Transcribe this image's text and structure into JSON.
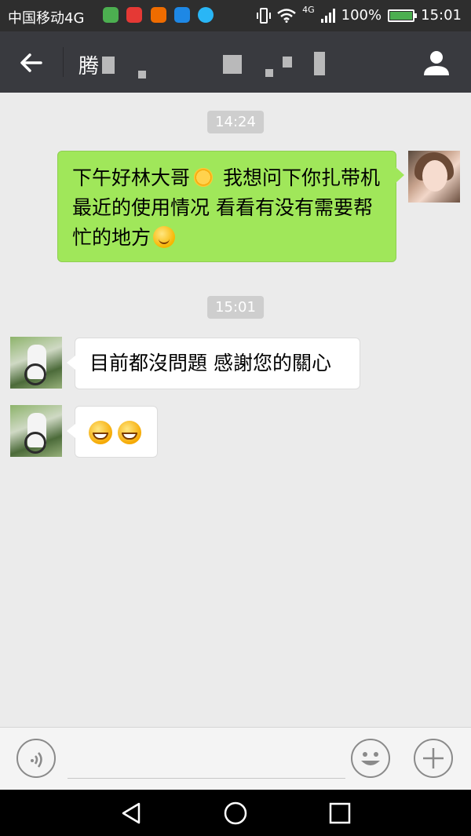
{
  "status_bar": {
    "carrier": "中国移动4G",
    "network": "4G",
    "battery": "100%",
    "battery_level": 1.0,
    "time": "15:01",
    "notification_icons": [
      "wechat-icon",
      "mail-icon",
      "sad-face-icon",
      "gallery-icon",
      "message-icon"
    ],
    "notification_colors": [
      "#4caf50",
      "#e53935",
      "#ef6c00",
      "#1e88e5",
      "#29b6f6"
    ]
  },
  "title_bar": {
    "title": "腾"
  },
  "messages": [
    {
      "type": "timestamp",
      "text": "14:24"
    },
    {
      "type": "sent",
      "text_part1": "下午好林大哥",
      "text_part2": " 我想问下你扎带机最近的使用情况 看看有没有需要帮忙的地方",
      "emoji": [
        "sun-emoji",
        "smile-emoji"
      ]
    },
    {
      "type": "timestamp",
      "text": "15:01"
    },
    {
      "type": "received",
      "text": "目前都沒問題 感謝您的關心"
    },
    {
      "type": "received",
      "emoji": [
        "grin-emoji",
        "grin-emoji"
      ]
    }
  ],
  "input_bar": {
    "placeholder": ""
  },
  "colors": {
    "sent_bubble": "#a0e75a",
    "received_bubble": "#ffffff",
    "title_bar": "#393a3f",
    "chat_background": "#ebebeb"
  }
}
